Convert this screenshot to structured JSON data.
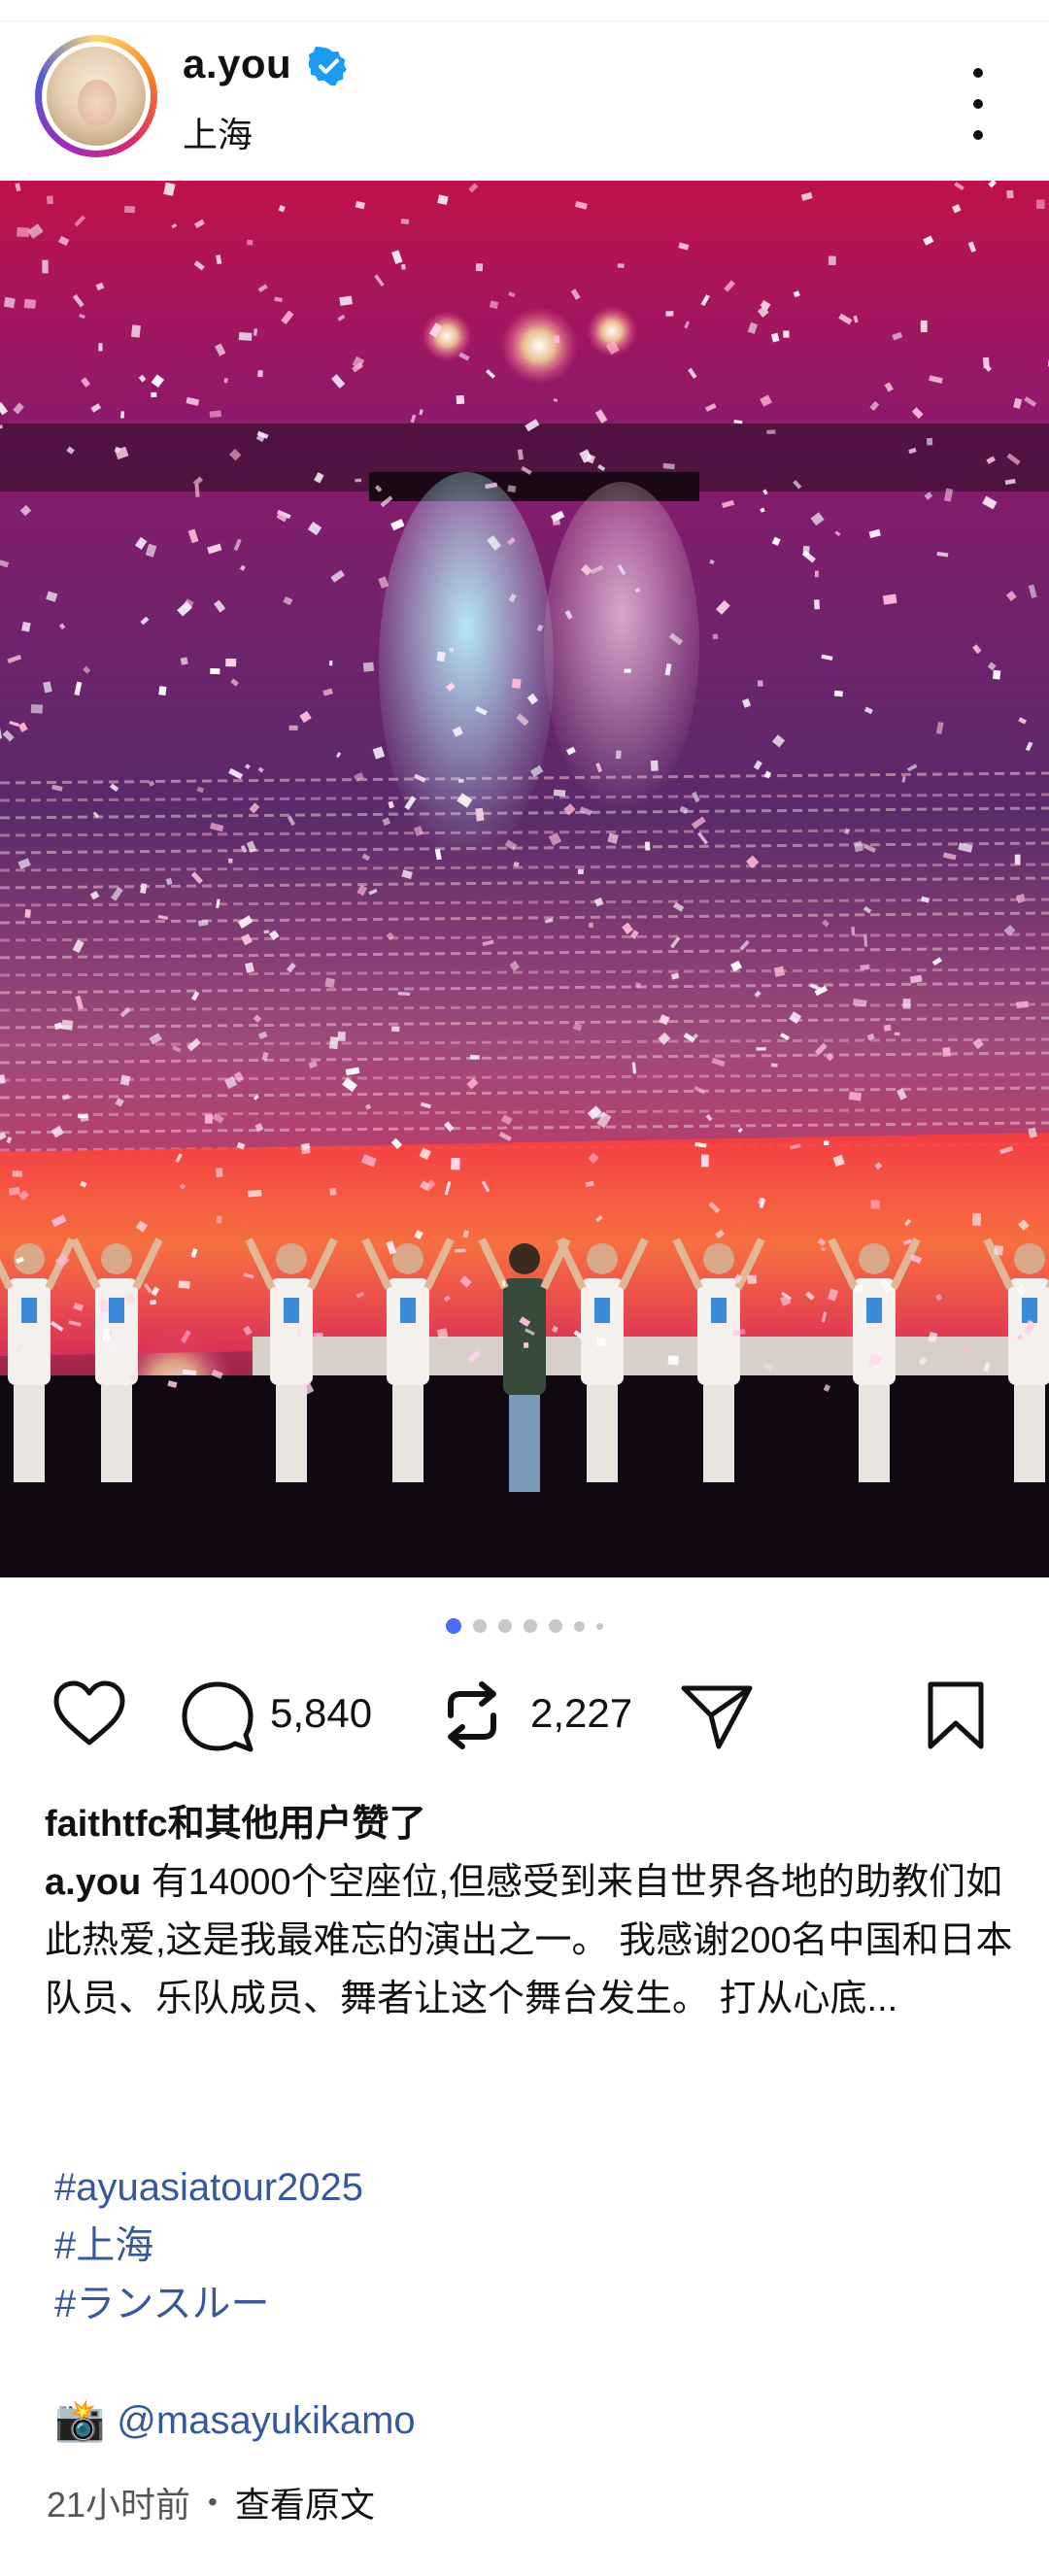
{
  "post": {
    "username": "a.you",
    "location": "上海",
    "verified": true
  },
  "carousel": {
    "count": 7,
    "active_index": 0
  },
  "actions": {
    "comment_count": "5,840",
    "repost_count": "2,227"
  },
  "likes_text": "faithtfc和其他用户赞了",
  "caption": {
    "user": "a.you",
    "text": " 有14000个空座位,但感受到来自世界各地的助教们如此热爱,这是我最难忘的演出之一。 我感谢200名中国和日本队员、乐队成员、舞者让这个舞台发生。 打从心底..."
  },
  "hashtags": [
    "#ayuasiatour2025",
    "#上海",
    "#ランスルー"
  ],
  "credit": {
    "icon": "camera-flash-emoji",
    "handle": "@masayukikamo"
  },
  "meta": {
    "time": "21小时前",
    "separator": "•",
    "view_original": "查看原文"
  },
  "colors": {
    "link": "#385898",
    "verified": "#1d9bf0",
    "active_dot": "#4a6cf7"
  }
}
